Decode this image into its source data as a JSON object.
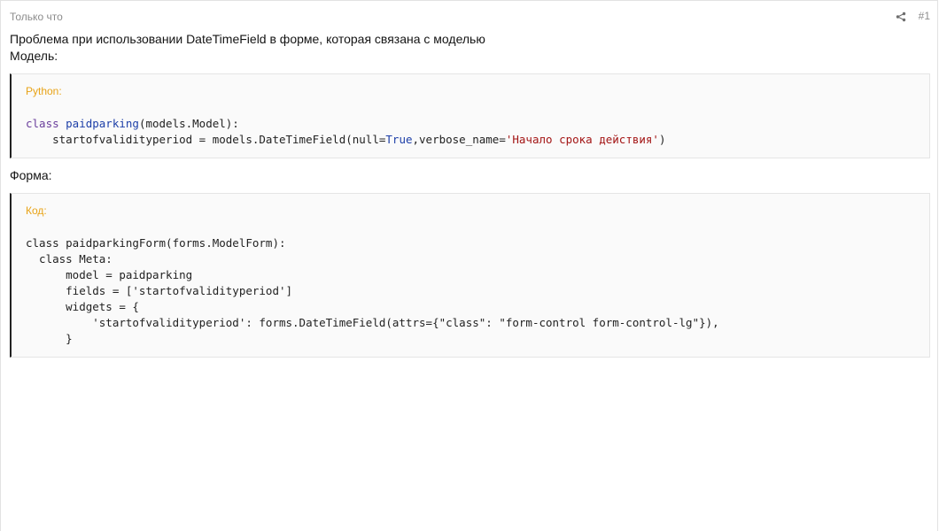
{
  "header": {
    "time": "Только что",
    "post_number": "#1",
    "share_icon": "share-icon"
  },
  "body": {
    "intro": "Проблема при использовании DateTimeField в форме, которая связана с моделью",
    "model_label": "Модель:",
    "form_label": "Форма:"
  },
  "code_blocks": [
    {
      "language": "Python:",
      "lines": [
        [
          {
            "t": "class ",
            "c": "kw"
          },
          {
            "t": "paidparking",
            "c": "fn"
          },
          {
            "t": "(models.Model):",
            "c": ""
          }
        ],
        [
          {
            "t": "    startofvalidityperiod = models.DateTimeField(null=",
            "c": ""
          },
          {
            "t": "True",
            "c": "bi"
          },
          {
            "t": ",verbose_name=",
            "c": ""
          },
          {
            "t": "'Начало срока действия'",
            "c": "str"
          },
          {
            "t": ")",
            "c": ""
          }
        ]
      ]
    },
    {
      "language": "Код:",
      "lines": [
        [
          {
            "t": "class paidparkingForm(forms.ModelForm):",
            "c": ""
          }
        ],
        [
          {
            "t": "  class Meta:",
            "c": ""
          }
        ],
        [
          {
            "t": "      model = paidparking",
            "c": ""
          }
        ],
        [
          {
            "t": "      fields = ['startofvalidityperiod']",
            "c": ""
          }
        ],
        [
          {
            "t": "      widgets = {",
            "c": ""
          }
        ],
        [
          {
            "t": "          'startofvalidityperiod': forms.DateTimeField(attrs={\"class\": \"form-control form-control-lg\"}),",
            "c": ""
          }
        ],
        [
          {
            "t": "      }",
            "c": ""
          }
        ]
      ]
    }
  ],
  "colors": {
    "accent_language_label": "#e8a317",
    "keyword": "#6a3e9c",
    "function_name": "#1d3fa8",
    "string": "#a31515",
    "block_border": "#222222"
  }
}
